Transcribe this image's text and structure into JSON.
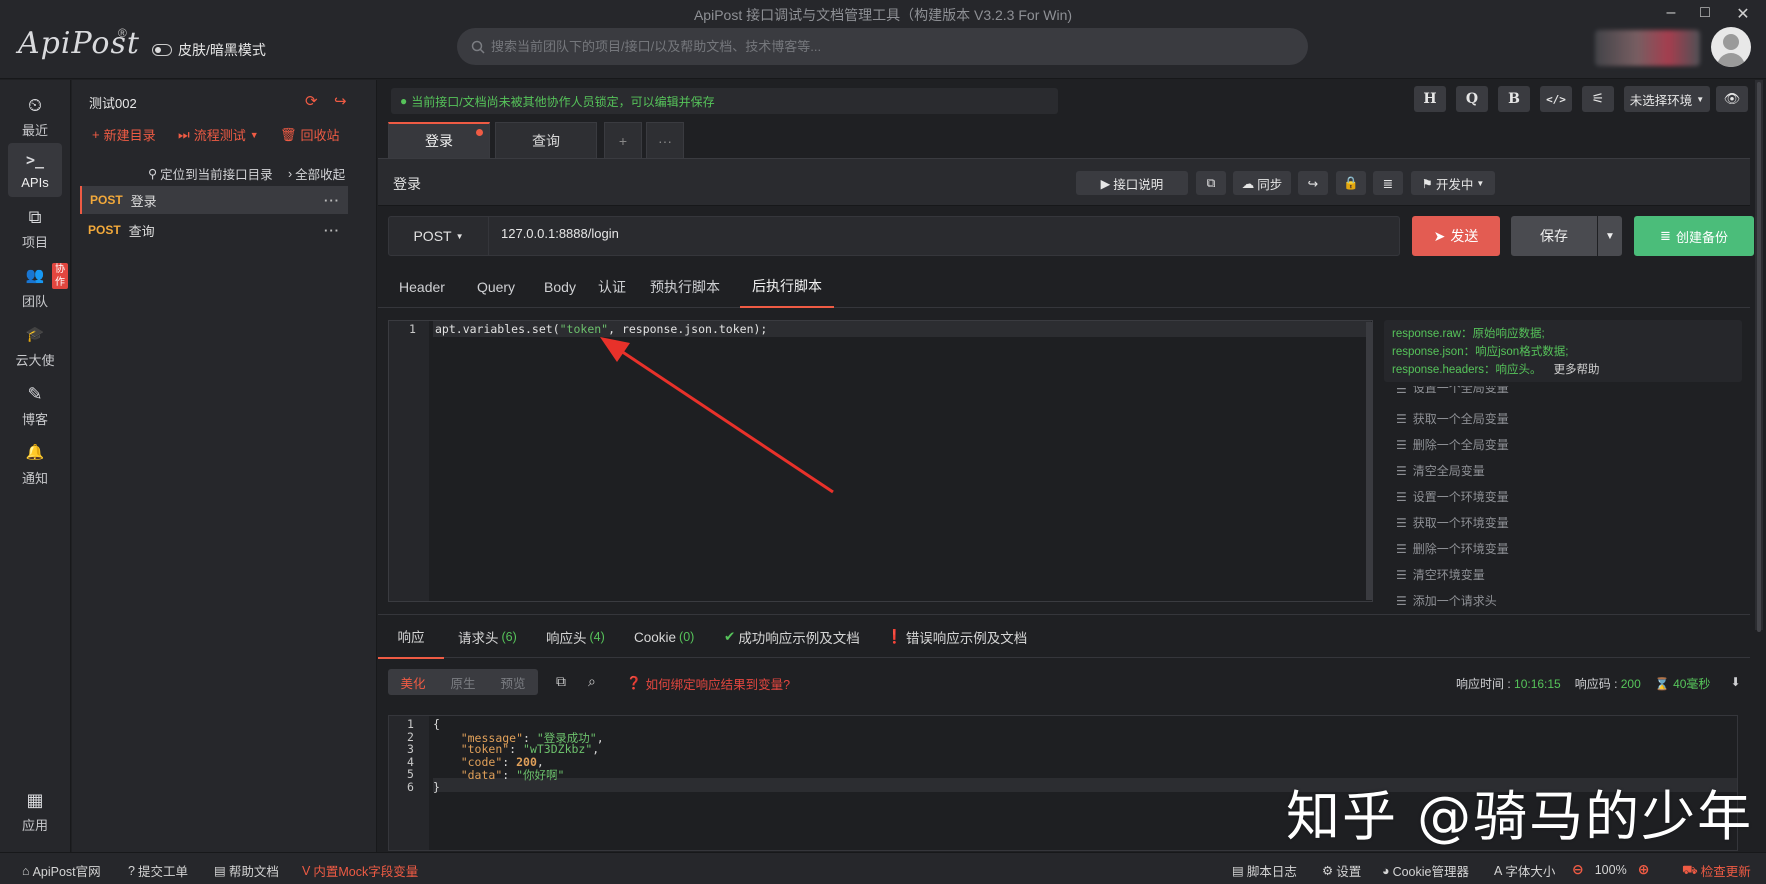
{
  "window": {
    "title": "ApiPost 接口调试与文档管理工具（构建版本 V3.2.3 For Win)",
    "min": "–",
    "max": "□",
    "close": "✕"
  },
  "app": {
    "logo": "ApiPost",
    "logo_mark": "®",
    "theme_toggle_label": "皮肤/暗黑模式",
    "search_placeholder": "搜索当前团队下的项目/接口/以及帮助文档、技术博客等..."
  },
  "rail": [
    {
      "label": "最近",
      "icon": "clock-icon",
      "glyph": "⏲"
    },
    {
      "label": "APIs",
      "icon": "terminal-icon",
      "glyph": ">_"
    },
    {
      "label": "项目",
      "icon": "project-icon",
      "glyph": "⧉"
    },
    {
      "label": "团队",
      "icon": "team-icon",
      "glyph": "👥",
      "badge": "协作"
    },
    {
      "label": "云大使",
      "icon": "graduation-icon",
      "glyph": "🎓"
    },
    {
      "label": "博客",
      "icon": "edit-icon",
      "glyph": "✎"
    },
    {
      "label": "通知",
      "icon": "bell-icon",
      "glyph": "🔔"
    },
    {
      "label": "应用",
      "icon": "apps-icon",
      "glyph": "▦"
    }
  ],
  "tree": {
    "project": "测试002",
    "new_dir": "新建目录",
    "flow_test": "流程测试",
    "recycle": "回收站",
    "locate": "定位到当前接口目录",
    "collapse": "全部收起",
    "apis": [
      {
        "method": "POST",
        "name": "登录"
      },
      {
        "method": "POST",
        "name": "查询"
      }
    ]
  },
  "notice": "当前接口/文档尚未被其他协作人员锁定，可以编辑并保存",
  "toolbar": {
    "h": "H",
    "q": "Q",
    "b": "B",
    "code": "</>",
    "sliders": "⚟",
    "env": "未选择环境"
  },
  "tabs": [
    {
      "label": "登录"
    },
    {
      "label": "查询"
    }
  ],
  "tab_add": "+",
  "tab_more": "···",
  "request": {
    "name": "登录",
    "doc_btn": "接口说明",
    "sync_btn": "同步",
    "status_btn": "开发中",
    "method": "POST",
    "url": "127.0.0.1:8888/login",
    "send": "发送",
    "save": "保存",
    "backup": "创建备份"
  },
  "req_tabs": [
    "Header",
    "Query",
    "Body",
    "认证",
    "预执行脚本",
    "后执行脚本"
  ],
  "script": {
    "line_no": "1",
    "prefix": "apt.variables.set(",
    "str": "\"token\"",
    "suffix": ", response.json.token);"
  },
  "help": {
    "lines": [
      "response.raw：原始响应数据;",
      "response.json：响应json格式数据;",
      "response.headers：响应头。"
    ],
    "more": "更多帮助",
    "snippets": [
      "设置一个全局变量",
      "获取一个全局变量",
      "删除一个全局变量",
      "清空全局变量",
      "设置一个环境变量",
      "获取一个环境变量",
      "删除一个环境变量",
      "清空环境变量",
      "添加一个请求头"
    ]
  },
  "resp_tabs": [
    {
      "label": "响应",
      "count": ""
    },
    {
      "label": "请求头",
      "count": "(6)"
    },
    {
      "label": "响应头",
      "count": "(4)"
    },
    {
      "label": "Cookie",
      "count": "(0)"
    },
    {
      "label": "成功响应示例及文档",
      "count": ""
    },
    {
      "label": "错误响应示例及文档",
      "count": ""
    }
  ],
  "resp_format": [
    "美化",
    "原生",
    "预览"
  ],
  "bind_tip": "如何绑定响应结果到变量?",
  "resp_meta": {
    "time_label": "响应时间 :",
    "time": "10:16:15",
    "code_label": "响应码 :",
    "code": "200",
    "duration": "40毫秒"
  },
  "response": {
    "lines": [
      "1",
      "2",
      "3",
      "4",
      "5",
      "6"
    ],
    "message_key": "\"message\"",
    "message_val": "\"登录成功\"",
    "token_key": "\"token\"",
    "token_val": "\"wT3DZkbz\"",
    "code_key": "\"code\"",
    "code_val": "200",
    "data_key": "\"data\"",
    "data_val": "\"你好啊\""
  },
  "watermark": "知乎 @骑马的少年",
  "status": {
    "home": "ApiPost官网",
    "ticket": "提交工单",
    "help": "帮助文档",
    "mock": "内置Mock字段变量",
    "script_log": "脚本日志",
    "settings": "设置",
    "cookie": "Cookie管理器",
    "font": "字体大小",
    "zoom": "100%",
    "update": "检查更新"
  },
  "colors": {
    "accent": "#ef5b44",
    "success": "#56c35a",
    "send": "#e35c52",
    "backup": "#4bbd7a",
    "method": "#f2a93b"
  }
}
